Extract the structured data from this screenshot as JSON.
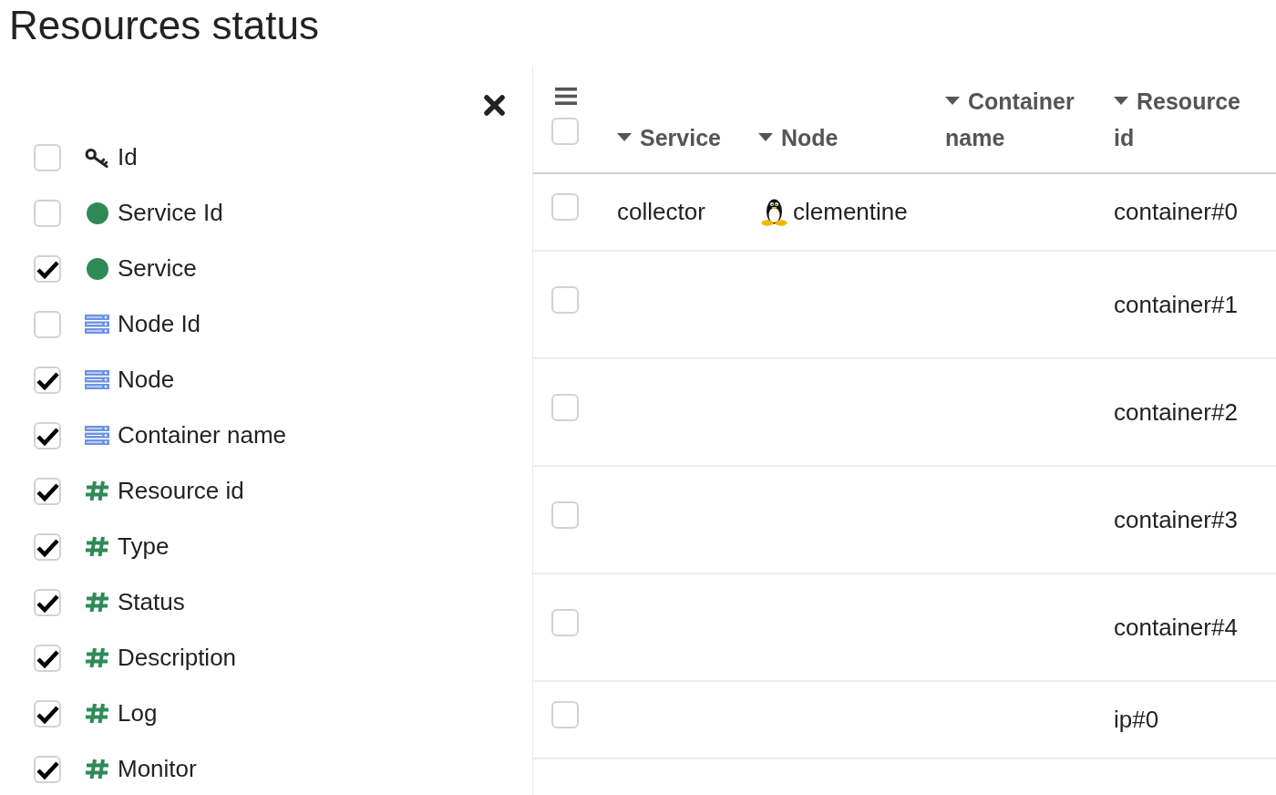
{
  "page": {
    "title": "Resources status"
  },
  "column_picker": {
    "items": [
      {
        "label": "Id",
        "kind": "key",
        "checked": false
      },
      {
        "label": "Service Id",
        "kind": "service",
        "checked": false
      },
      {
        "label": "Service",
        "kind": "service",
        "checked": true
      },
      {
        "label": "Node Id",
        "kind": "node",
        "checked": false
      },
      {
        "label": "Node",
        "kind": "node",
        "checked": true
      },
      {
        "label": "Container name",
        "kind": "node",
        "checked": true
      },
      {
        "label": "Resource id",
        "kind": "resource",
        "checked": true
      },
      {
        "label": "Type",
        "kind": "resource",
        "checked": true
      },
      {
        "label": "Status",
        "kind": "resource",
        "checked": true
      },
      {
        "label": "Description",
        "kind": "resource",
        "checked": true
      },
      {
        "label": "Log",
        "kind": "resource",
        "checked": true
      },
      {
        "label": "Monitor",
        "kind": "resource",
        "checked": true
      }
    ]
  },
  "table": {
    "select_all": {
      "checked": false
    },
    "columns": [
      {
        "label": "Service"
      },
      {
        "label": "Node"
      },
      {
        "label": "Container name"
      },
      {
        "label": "Resource id"
      }
    ],
    "rows": [
      {
        "selected": false,
        "service": "collector",
        "node": "clementine",
        "resource_id": "container#0"
      },
      {
        "selected": false,
        "resource_id": "container#1"
      },
      {
        "selected": false,
        "resource_id": "container#2"
      },
      {
        "selected": false,
        "resource_id": "container#3"
      },
      {
        "selected": false,
        "resource_id": "container#4"
      },
      {
        "selected": false,
        "resource_id": "ip#0"
      }
    ]
  }
}
